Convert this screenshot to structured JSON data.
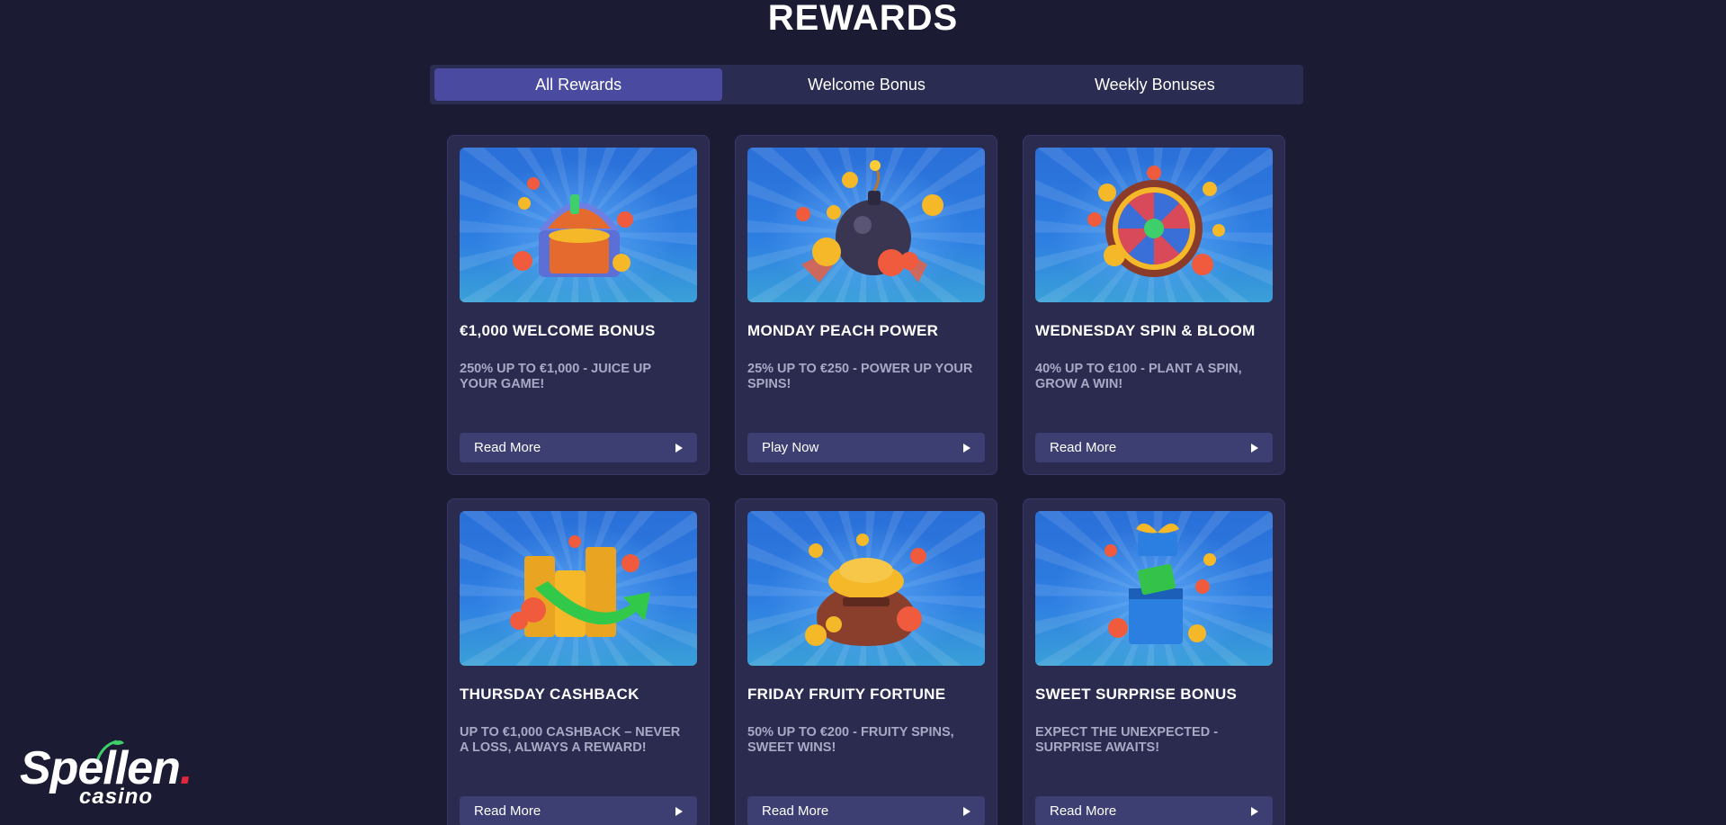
{
  "page": {
    "title": "REWARDS"
  },
  "tabs": [
    {
      "label": "All Rewards",
      "active": true
    },
    {
      "label": "Welcome Bonus",
      "active": false
    },
    {
      "label": "Weekly Bonuses",
      "active": false
    }
  ],
  "cards": [
    {
      "title": "€1,000 WELCOME BONUS",
      "description": "250% UP TO €1,000 - JUICE UP YOUR GAME!",
      "button": "Read More",
      "image": "treasure-chest-icon"
    },
    {
      "title": "MONDAY PEACH POWER",
      "description": "25% UP TO €250 - POWER UP YOUR SPINS!",
      "button": "Play Now",
      "image": "bomb-icon"
    },
    {
      "title": "WEDNESDAY SPIN & BLOOM",
      "description": "40% UP TO €100 - PLANT A SPIN, GROW A WIN!",
      "button": "Read More",
      "image": "prize-wheel-icon"
    },
    {
      "title": "THURSDAY CASHBACK",
      "description": "UP TO €1,000 CASHBACK – NEVER A LOSS, ALWAYS A REWARD!",
      "button": "Read More",
      "image": "coin-stack-arrow-icon"
    },
    {
      "title": "FRIDAY FRUITY FORTUNE",
      "description": "50% UP TO €200 - FRUITY SPINS, SWEET WINS!",
      "button": "Read More",
      "image": "coin-sack-icon"
    },
    {
      "title": "SWEET SURPRISE BONUS",
      "description": "EXPECT THE UNEXPECTED - SURPRISE AWAITS!",
      "button": "Read More",
      "image": "gift-box-icon"
    }
  ],
  "logo": {
    "main": "Spellen",
    "dot": ".",
    "sub": "casino"
  },
  "colors": {
    "background": "#1b1b33",
    "card": "#2a2b4f",
    "tab_bar": "#2b2c52",
    "tab_active": "#4a4aa0",
    "button": "#3d3e72",
    "description": "#a9a9c6",
    "image_blue": "#2e7fe2",
    "coin_gold": "#f4b829",
    "peach_red": "#ef5b3c",
    "logo_red": "#e3263c"
  }
}
